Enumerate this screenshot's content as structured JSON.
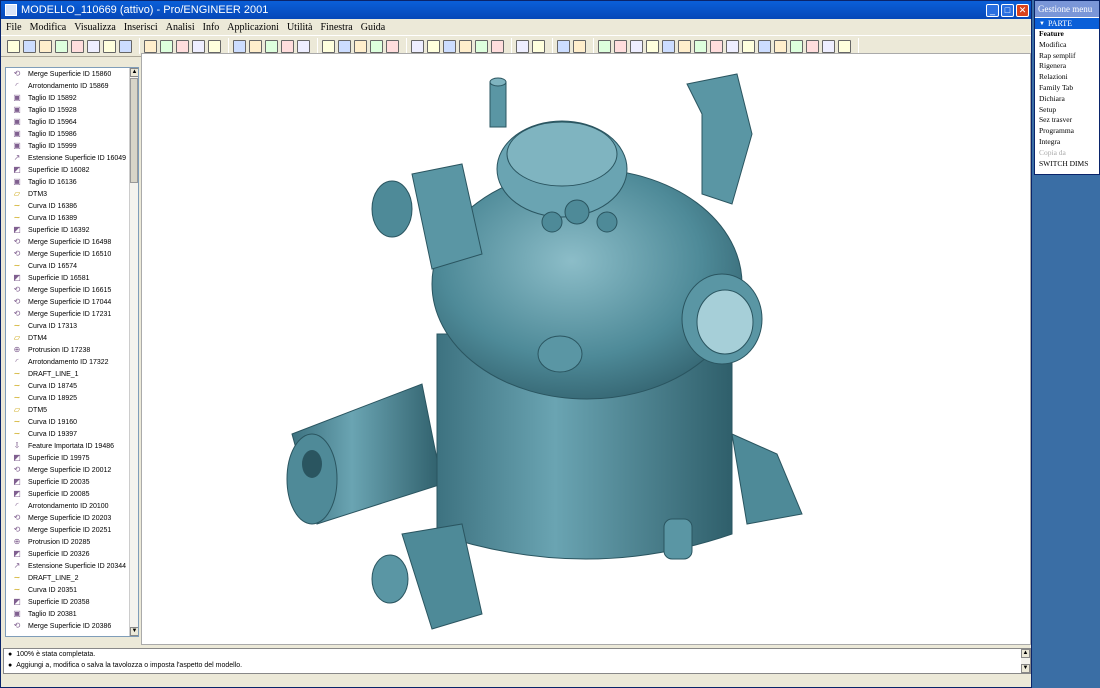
{
  "window": {
    "title": "MODELLO_110669 (attivo) - Pro/ENGINEER 2001"
  },
  "menubar": [
    "File",
    "Modifica",
    "Visualizza",
    "Inserisci",
    "Analisi",
    "Info",
    "Applicazioni",
    "Utilità",
    "Finestra",
    "Guida"
  ],
  "tree": [
    {
      "label": "Merge Superficie ID 15860",
      "icon": "merge-icon"
    },
    {
      "label": "Arrotondamento ID 15869",
      "icon": "round-icon"
    },
    {
      "label": "Taglio ID 15892",
      "icon": "cut-icon"
    },
    {
      "label": "Taglio ID 15928",
      "icon": "cut-icon"
    },
    {
      "label": "Taglio ID 15964",
      "icon": "cut-icon"
    },
    {
      "label": "Taglio ID 15986",
      "icon": "cut-icon"
    },
    {
      "label": "Taglio ID 15999",
      "icon": "cut-icon"
    },
    {
      "label": "Estensione Superficie ID 16049",
      "icon": "extend-icon"
    },
    {
      "label": "Superficie ID 16082",
      "icon": "surface-icon"
    },
    {
      "label": "Taglio ID 16136",
      "icon": "cut-icon"
    },
    {
      "label": "DTM3",
      "icon": "datum-plane-icon"
    },
    {
      "label": "Curva ID 16386",
      "icon": "curve-icon"
    },
    {
      "label": "Curva ID 16389",
      "icon": "curve-icon"
    },
    {
      "label": "Superficie ID 16392",
      "icon": "surface-icon"
    },
    {
      "label": "Merge Superficie ID 16498",
      "icon": "merge-icon"
    },
    {
      "label": "Merge Superficie ID 16510",
      "icon": "merge-icon"
    },
    {
      "label": "Curva ID 16574",
      "icon": "curve-icon"
    },
    {
      "label": "Superficie ID 16581",
      "icon": "surface-icon"
    },
    {
      "label": "Merge Superficie ID 16615",
      "icon": "merge-icon"
    },
    {
      "label": "Merge Superficie ID 17044",
      "icon": "merge-icon"
    },
    {
      "label": "Merge Superficie ID 17231",
      "icon": "merge-icon"
    },
    {
      "label": "Curva ID 17313",
      "icon": "curve-icon"
    },
    {
      "label": "DTM4",
      "icon": "datum-plane-icon"
    },
    {
      "label": "Protrusion ID 17238",
      "icon": "protrusion-icon"
    },
    {
      "label": "Arrotondamento ID 17322",
      "icon": "round-icon"
    },
    {
      "label": "DRAFT_LINE_1",
      "icon": "curve-icon"
    },
    {
      "label": "Curva ID 18745",
      "icon": "curve-icon"
    },
    {
      "label": "Curva ID 18925",
      "icon": "curve-icon"
    },
    {
      "label": "DTM5",
      "icon": "datum-plane-icon"
    },
    {
      "label": "Curva ID 19160",
      "icon": "curve-icon"
    },
    {
      "label": "Curva ID 19397",
      "icon": "curve-icon"
    },
    {
      "label": "Feature Importata ID 19486",
      "icon": "import-icon"
    },
    {
      "label": "Superficie ID 19975",
      "icon": "surface-icon"
    },
    {
      "label": "Merge Superficie ID 20012",
      "icon": "merge-icon"
    },
    {
      "label": "Superficie ID 20035",
      "icon": "surface-icon"
    },
    {
      "label": "Superficie ID 20085",
      "icon": "surface-icon"
    },
    {
      "label": "Arrotondamento ID 20100",
      "icon": "round-icon"
    },
    {
      "label": "Merge Superficie ID 20203",
      "icon": "merge-icon"
    },
    {
      "label": "Merge Superficie ID 20251",
      "icon": "merge-icon"
    },
    {
      "label": "Protrusion ID 20285",
      "icon": "protrusion-icon"
    },
    {
      "label": "Superficie ID 20326",
      "icon": "surface-icon"
    },
    {
      "label": "Estensione Superficie ID 20344",
      "icon": "extend-icon"
    },
    {
      "label": "DRAFT_LINE_2",
      "icon": "curve-icon"
    },
    {
      "label": "Curva ID 20351",
      "icon": "curve-icon"
    },
    {
      "label": "Superficie ID 20358",
      "icon": "surface-icon"
    },
    {
      "label": "Taglio ID 20381",
      "icon": "cut-icon"
    },
    {
      "label": "Merge Superficie ID 20386",
      "icon": "merge-icon"
    }
  ],
  "messages": [
    "100% è stata completata.",
    "Aggiungi a, modifica o salva la tavolozza o imposta l'aspetto del modello."
  ],
  "menu_manager": {
    "title": "Gestione menu",
    "section": "PARTE",
    "items": [
      {
        "label": "Feature",
        "style": "bold"
      },
      {
        "label": "Modifica",
        "style": "normal"
      },
      {
        "label": "Rap semplif",
        "style": "normal"
      },
      {
        "label": "Rigenera",
        "style": "normal"
      },
      {
        "label": "Relazioni",
        "style": "normal"
      },
      {
        "label": "Family Tab",
        "style": "normal"
      },
      {
        "label": "Dichiara",
        "style": "normal"
      },
      {
        "label": "Setup",
        "style": "normal"
      },
      {
        "label": "Sez trasver",
        "style": "normal"
      },
      {
        "label": "Programma",
        "style": "normal"
      },
      {
        "label": "Integra",
        "style": "normal"
      },
      {
        "label": "Copia da",
        "style": "disabled"
      },
      {
        "label": "SWITCH DIMS",
        "style": "normal"
      }
    ]
  },
  "model_color": "#4e8a98",
  "accent": "#0a5fd8"
}
